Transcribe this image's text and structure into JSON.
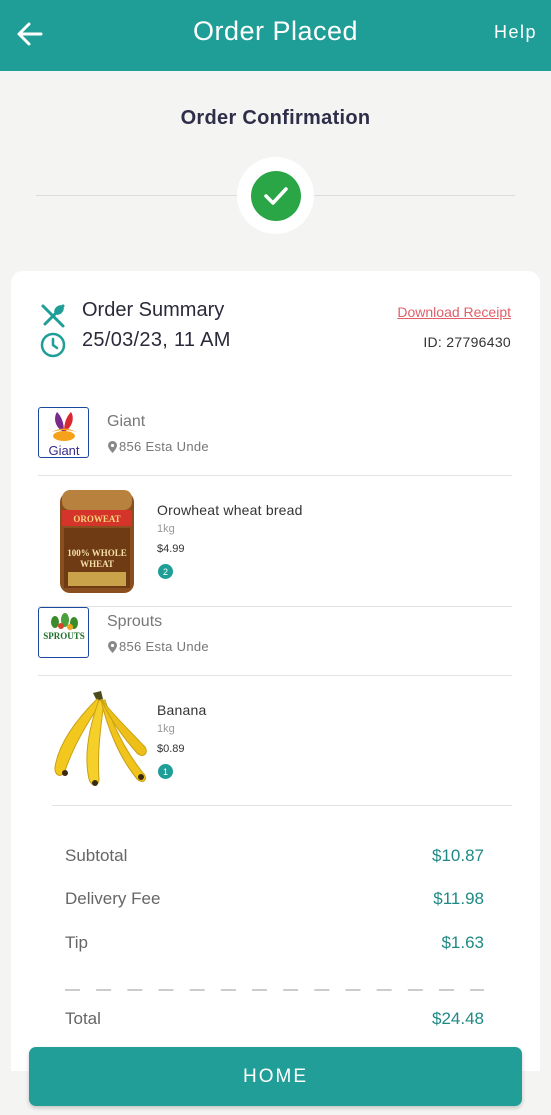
{
  "appbar": {
    "title": "Order Placed",
    "help": "Help"
  },
  "confirmation": {
    "heading": "Order Confirmation"
  },
  "summary": {
    "title": "Order Summary",
    "datetime": "25/03/23, 11 AM",
    "download_label": "Download Receipt",
    "order_id": "ID: 27796430"
  },
  "stores": [
    {
      "name": "Giant",
      "address": "856 Esta Unde",
      "logo_text": "Giant",
      "items": [
        {
          "name": "Orowheat wheat bread",
          "qty": "1kg",
          "price": "$4.99",
          "count": "2",
          "image_text": [
            "OROWEAT",
            "100% WHOLE",
            "WHEAT"
          ]
        }
      ]
    },
    {
      "name": "Sprouts",
      "address": "856 Esta Unde",
      "logo_text": "SPROUTS",
      "items": [
        {
          "name": "Banana",
          "qty": "1kg",
          "price": "$0.89",
          "count": "1"
        }
      ]
    }
  ],
  "totals": {
    "subtotal_label": "Subtotal",
    "subtotal": "$10.87",
    "delivery_label": "Delivery Fee",
    "delivery": "$11.98",
    "tip_label": "Tip",
    "tip": "$1.63",
    "total_label": "Total",
    "total": "$24.48"
  },
  "home_button": "HOME",
  "colors": {
    "primary": "#1f9e98",
    "success": "#2aa646",
    "link": "#e0606a"
  }
}
